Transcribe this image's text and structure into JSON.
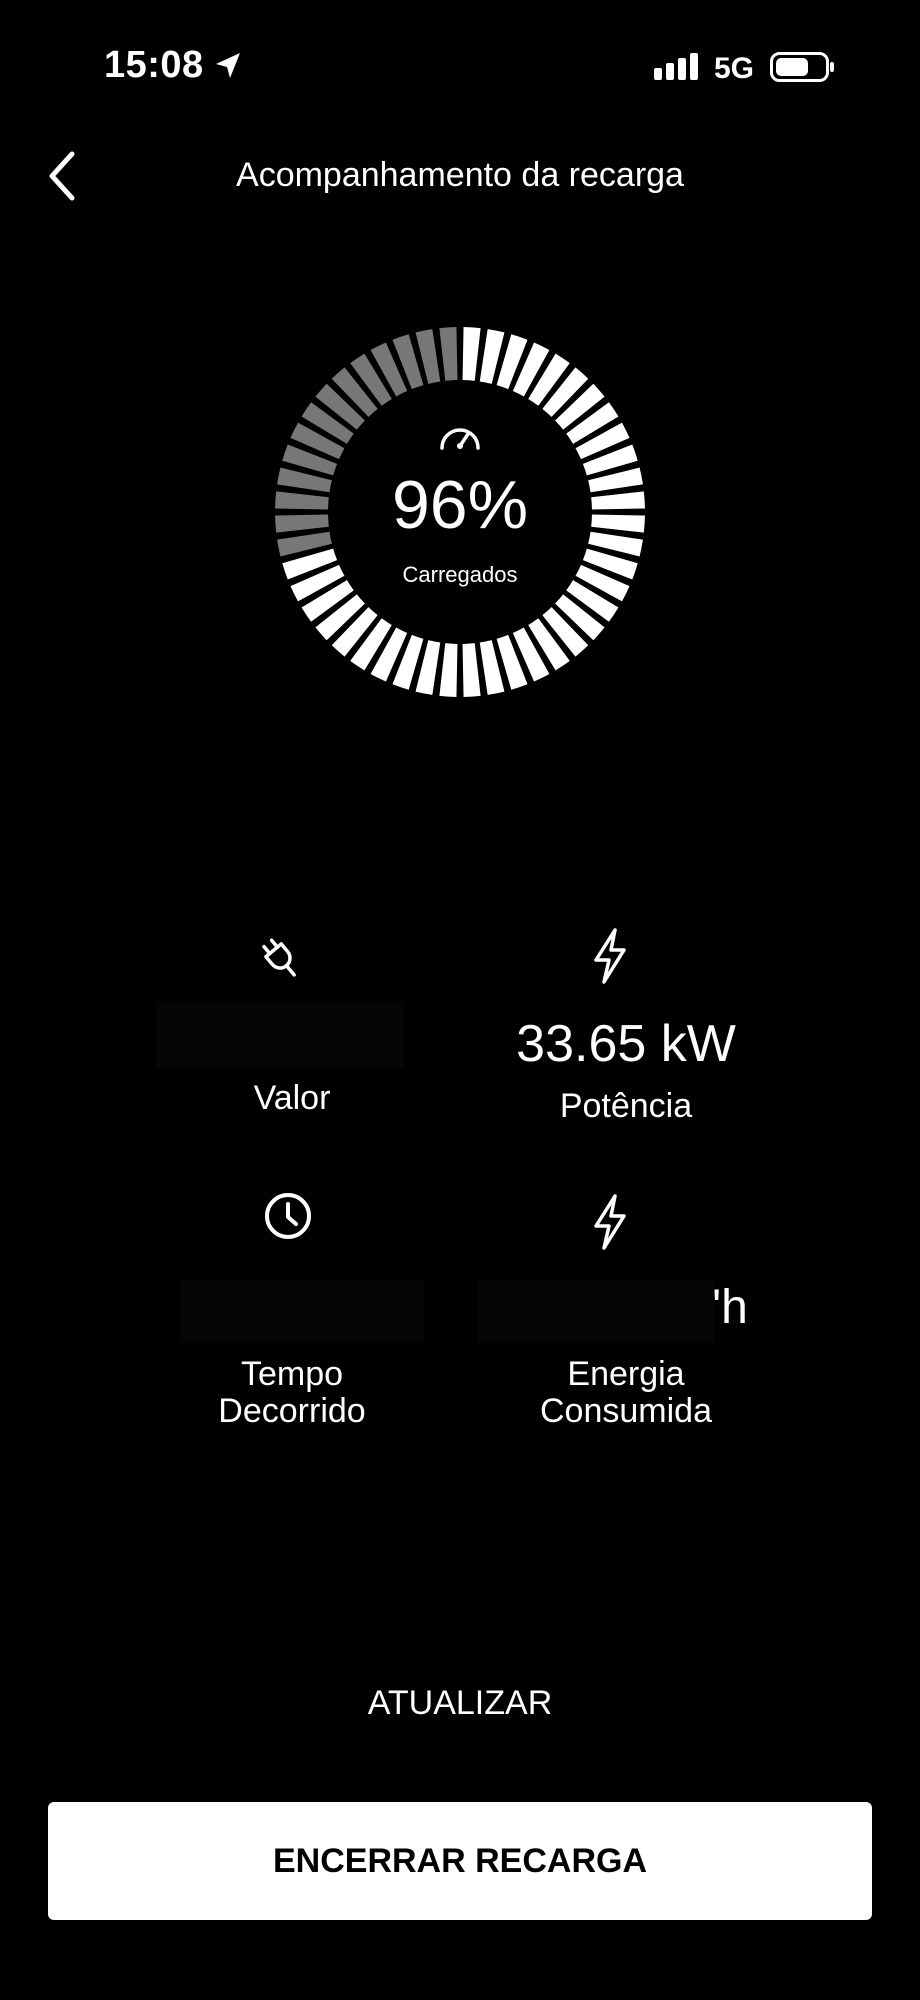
{
  "status_bar": {
    "time": "15:08",
    "network": "5G",
    "icons": [
      "location-arrow-icon",
      "signal-icon",
      "battery-icon"
    ]
  },
  "header": {
    "title": "Acompanhamento da recarga",
    "back_icon": "chevron-left-icon"
  },
  "charge": {
    "percent_text": "96%",
    "label": "Carregados",
    "level": 0.96,
    "icon": "speedometer-icon"
  },
  "metrics": {
    "valor": {
      "label": "Valor",
      "value": "",
      "icon": "plug-icon"
    },
    "potencia": {
      "label": "Potência",
      "value": "33.65 kW",
      "icon": "bolt-icon"
    },
    "tempo": {
      "label_line1": "Tempo",
      "label_line2": "Decorrido",
      "value": "",
      "icon": "clock-icon"
    },
    "energia": {
      "label_line1": "Energia",
      "label_line2": "Consumida",
      "value_visible": "'h",
      "icon": "bolt-icon"
    }
  },
  "actions": {
    "update_label": "ATUALIZAR",
    "end_label": "ENCERRAR RECARGA"
  },
  "colors": {
    "background": "#000000",
    "ring_filled": "#ffffff",
    "ring_dim": "#777777",
    "button_bg": "#ffffff"
  }
}
